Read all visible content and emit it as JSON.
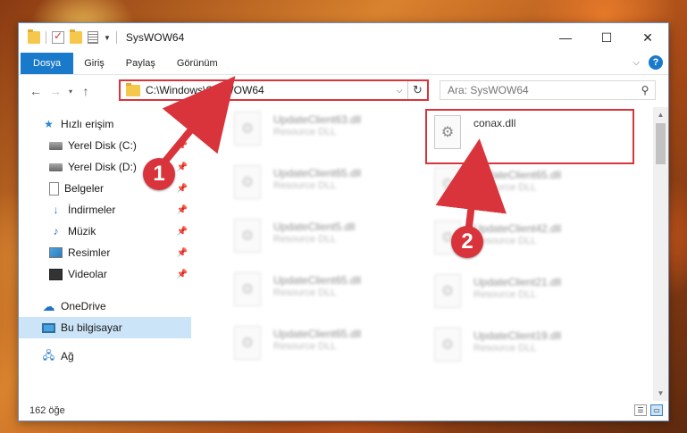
{
  "window": {
    "title": "SysWOW64",
    "controls": {
      "minimize": "—",
      "maximize": "☐",
      "close": "✕"
    }
  },
  "ribbon": {
    "tabs": [
      "Dosya",
      "Giriş",
      "Paylaş",
      "Görünüm"
    ],
    "active_tab": "Dosya",
    "help": "?"
  },
  "nav": {
    "back": "←",
    "forward": "→",
    "recent": "▾",
    "up": "↑",
    "address": "C:\\Windows\\SysWOW64",
    "search_placeholder": "Ara: SysWOW64"
  },
  "sidebar": {
    "items": [
      {
        "label": "Hızlı erişim",
        "icon": "star-icon"
      },
      {
        "label": "Yerel Disk (C:)",
        "icon": "disk-icon",
        "pinned": true
      },
      {
        "label": "Yerel Disk (D:)",
        "icon": "disk-icon",
        "pinned": true
      },
      {
        "label": "Belgeler",
        "icon": "document-icon",
        "pinned": true
      },
      {
        "label": "İndirmeler",
        "icon": "download-icon",
        "pinned": true
      },
      {
        "label": "Müzik",
        "icon": "music-icon",
        "pinned": true
      },
      {
        "label": "Resimler",
        "icon": "picture-icon",
        "pinned": true
      },
      {
        "label": "Videolar",
        "icon": "video-icon",
        "pinned": true
      },
      {
        "label": "OneDrive",
        "icon": "cloud-icon"
      },
      {
        "label": "Bu bilgisayar",
        "icon": "computer-icon",
        "selected": true
      },
      {
        "label": "Ağ",
        "icon": "network-icon"
      }
    ]
  },
  "files": {
    "col1": [
      {
        "name": "UpdateClient63.dll",
        "type": "Resource DLL"
      },
      {
        "name": "UpdateClient65.dll",
        "type": "Resource DLL"
      },
      {
        "name": "UpdateClient5.dll",
        "type": "Resource DLL"
      },
      {
        "name": "UpdateClient65.dll",
        "type": "Resource DLL"
      },
      {
        "name": "UpdateClient65.dll",
        "type": "Resource DLL"
      }
    ],
    "col2": [
      {
        "name": "conax.dll",
        "type": ""
      },
      {
        "name": "UpdateClient65.dll",
        "type": "Resource DLL"
      },
      {
        "name": "UpdateClient42.dll",
        "type": "Resource DLL"
      },
      {
        "name": "UpdateClient21.dll",
        "type": "Resource DLL"
      },
      {
        "name": "UpdateClient19.dll",
        "type": "Resource DLL"
      }
    ]
  },
  "status": {
    "count": "162 öğe"
  },
  "callouts": {
    "one": "1",
    "two": "2",
    "color": "#d9343b"
  }
}
